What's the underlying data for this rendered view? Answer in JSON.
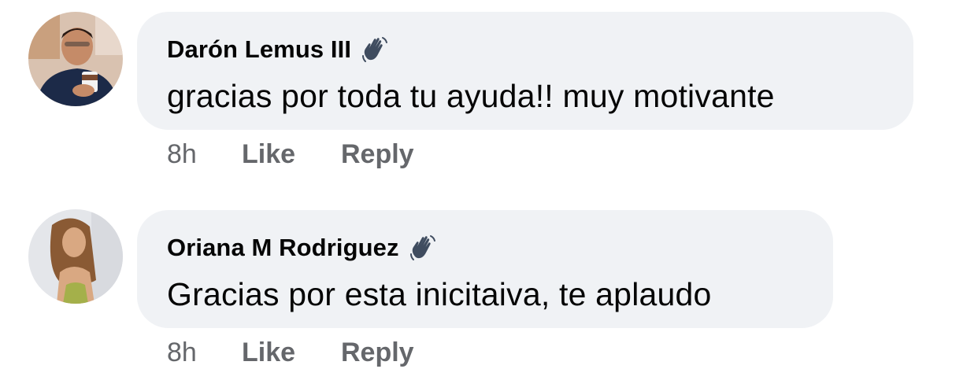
{
  "comments": [
    {
      "author": "Darón Lemus III",
      "text": "gracias por toda tu ayuda!! muy motivante",
      "time": "8h",
      "like_label": "Like",
      "reply_label": "Reply",
      "badge_icon": "wave-hand-icon"
    },
    {
      "author": "Oriana M Rodriguez",
      "text": "Gracias por esta inicitaiva, te aplaudo",
      "time": "8h",
      "like_label": "Like",
      "reply_label": "Reply",
      "badge_icon": "wave-hand-icon"
    }
  ],
  "colors": {
    "bubble_bg": "#f0f2f5",
    "meta_text": "#65676b",
    "primary_text": "#050505"
  }
}
